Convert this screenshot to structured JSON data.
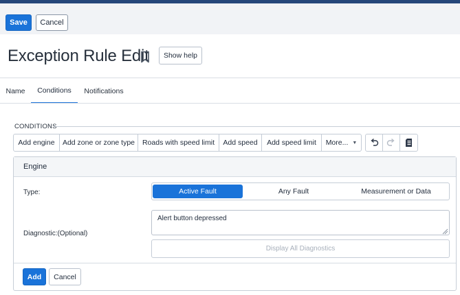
{
  "actions": {
    "save": "Save",
    "cancel": "Cancel"
  },
  "page": {
    "title": "Exception Rule Edit",
    "show_help": "Show help"
  },
  "tabs": [
    {
      "label": "Name",
      "active": false
    },
    {
      "label": "Conditions",
      "active": true
    },
    {
      "label": "Notifications",
      "active": false
    }
  ],
  "conditions": {
    "section_label": "CONDITIONS",
    "toolbar": [
      "Add engine",
      "Add zone or zone type",
      "Roads with speed limit",
      "Add speed",
      "Add speed limit",
      "More..."
    ],
    "icons": [
      "undo-icon",
      "redo-icon",
      "document-icon"
    ]
  },
  "engine": {
    "header": "Engine",
    "type_label": "Type:",
    "type_options": [
      "Active Fault",
      "Any Fault",
      "Measurement or Data"
    ],
    "type_selected": "Active Fault",
    "diagnostic_label": "Diagnostic:(Optional)",
    "diagnostic_value": "Alert button depressed",
    "display_all": "Display All Diagnostics",
    "add": "Add",
    "cancel": "Cancel"
  },
  "colors": {
    "primary": "#1a73d9",
    "topbar": "#25477a",
    "actionbar_bg": "#f1f3f6"
  }
}
